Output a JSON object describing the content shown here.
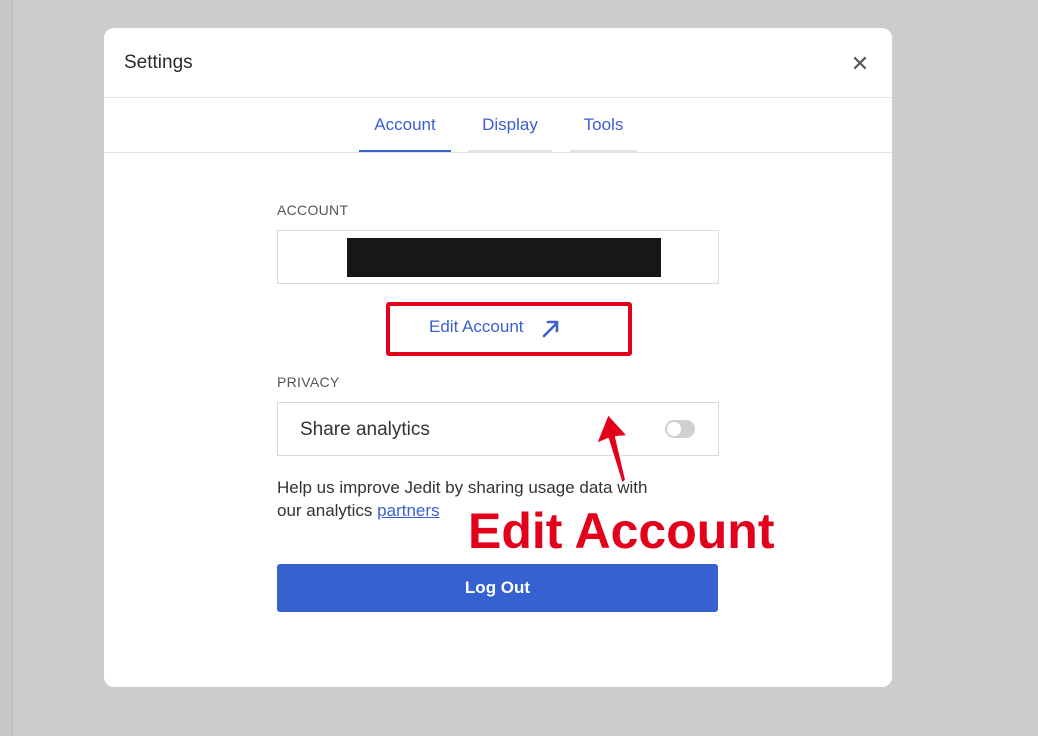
{
  "modal": {
    "title": "Settings",
    "close_symbol": "✕"
  },
  "tabs": [
    {
      "label": "Account",
      "active": true
    },
    {
      "label": "Display",
      "active": false
    },
    {
      "label": "Tools",
      "active": false
    }
  ],
  "account": {
    "section_label": "ACCOUNT",
    "edit_link_label": "Edit Account",
    "edit_link_icon": "external-arrow-icon"
  },
  "privacy": {
    "section_label": "PRIVACY",
    "share_analytics_label": "Share analytics",
    "share_analytics_enabled": false,
    "help_text_line1": "Help us improve Jedit by sharing usage data with",
    "help_text_line2_prefix": "our analytics",
    "help_text_link": "partners"
  },
  "logout_label": "Log Out",
  "annotation": {
    "callout_text": "Edit Account",
    "color": "#e3001b"
  },
  "colors": {
    "accent": "#3a5fcf",
    "button_bg": "#3562d0",
    "backdrop": "#cccccc",
    "highlight": "#e3001b"
  }
}
